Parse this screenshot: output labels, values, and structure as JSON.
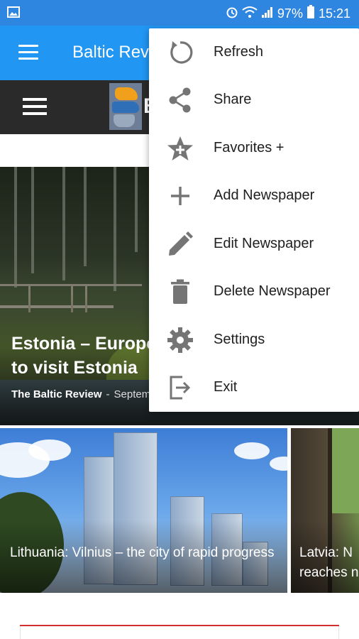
{
  "status_bar": {
    "battery": "97%",
    "time": "15:21",
    "icons": [
      "image-icon",
      "alarm-icon",
      "wifi-icon",
      "signal-icon",
      "battery-icon"
    ]
  },
  "app_bar": {
    "title": "Baltic Review"
  },
  "site_header": {
    "logo_letter": "B"
  },
  "hero": {
    "title": "Estonia – Europe's best … to visit Estonia",
    "title_visible": "Estonia – Europe\nto visit Estonia",
    "source": "The Baltic Review",
    "separator": "-",
    "date": "Septem"
  },
  "cards": [
    {
      "title": "Lithuania: Vilnius – the city of rapid progress"
    },
    {
      "title": "Latvia: N reaches n"
    }
  ],
  "menu": {
    "items": [
      {
        "label": "Refresh",
        "icon": "refresh-icon"
      },
      {
        "label": "Share",
        "icon": "share-icon"
      },
      {
        "label": "Favorites +",
        "icon": "favorites-star-icon"
      },
      {
        "label": "Add Newspaper",
        "icon": "plus-icon"
      },
      {
        "label": "Edit Newspaper",
        "icon": "pencil-icon"
      },
      {
        "label": "Delete Newspaper",
        "icon": "trash-icon"
      },
      {
        "label": "Settings",
        "icon": "gear-icon"
      },
      {
        "label": "Exit",
        "icon": "exit-icon"
      }
    ]
  },
  "colors": {
    "status_bar": "#2f86e0",
    "app_bar": "#2196f3",
    "site_header": "#2a2a2a",
    "menu_icon": "#757575",
    "accent_line": "#d32f2f"
  }
}
